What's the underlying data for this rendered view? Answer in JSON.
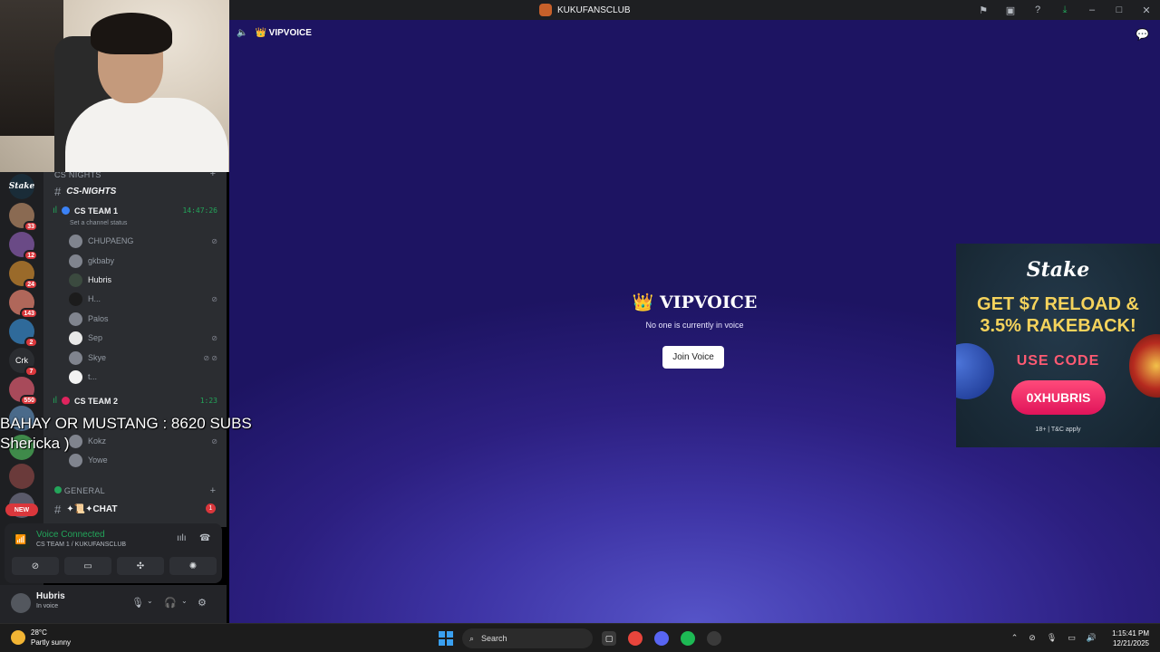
{
  "window": {
    "title": "KUKUFANSCLUB",
    "controls": [
      "minimize",
      "maximize",
      "close"
    ]
  },
  "servers": [
    {
      "label": "Stake",
      "badge": ""
    },
    {
      "label": "",
      "badge": "33"
    },
    {
      "label": "",
      "badge": "12"
    },
    {
      "label": "",
      "badge": "24"
    },
    {
      "label": "",
      "badge": "143"
    },
    {
      "label": "",
      "badge": "2"
    },
    {
      "label": "Crk",
      "badge": "7"
    },
    {
      "label": "",
      "badge": "550"
    },
    {
      "label": "",
      "badge": ""
    },
    {
      "label": "",
      "badge": ""
    },
    {
      "label": "",
      "badge": ""
    },
    {
      "label": "",
      "badge": ""
    }
  ],
  "servers_new_badge": "NEW",
  "sidebar": {
    "category_top": "CS NIGHTS",
    "text_channel": "CS-NIGHTS",
    "voice1": {
      "name": "CS TEAM 1",
      "time": "14:47:26",
      "status": "Set a channel status",
      "users": [
        "CHUPAENG",
        "gkbaby",
        "Hubris",
        "H...",
        "Palos",
        "Sep",
        "Skye",
        "t..."
      ]
    },
    "voice2": {
      "name": "CS TEAM 2",
      "time": "1:23",
      "users": [
        "Kokz",
        "Yowe"
      ]
    },
    "category_general": "GENERAL",
    "chat_channel": "✦📜✦CHAT",
    "chat_unread": "1"
  },
  "voice_panel": {
    "title": "Voice Connected",
    "subtitle": "CS TEAM 1 / KUKUFANSCLUB"
  },
  "user_panel": {
    "name": "Hubris",
    "status": "In voice"
  },
  "overlay": {
    "line1": "BAHAY OR MUSTANG : 8620 SUBS",
    "line2": "Shericka )"
  },
  "stage": {
    "header": "👑 VIPVOICE",
    "title": "👑 VIPVOICE",
    "subtitle": "No one is currently in voice",
    "join_label": "Join Voice"
  },
  "ad": {
    "logo": "Stake",
    "headline1": "GET $7 RELOAD &",
    "headline2": "3.5% RAKEBACK!",
    "use_code": "USE CODE",
    "code": "0XHUBRIS",
    "legal": "18+ | T&C apply"
  },
  "taskbar": {
    "weather_temp": "28°C",
    "weather_desc": "Partly sunny",
    "search_label": "Search",
    "time": "1:15:41 PM",
    "date": "12/21/2025"
  }
}
